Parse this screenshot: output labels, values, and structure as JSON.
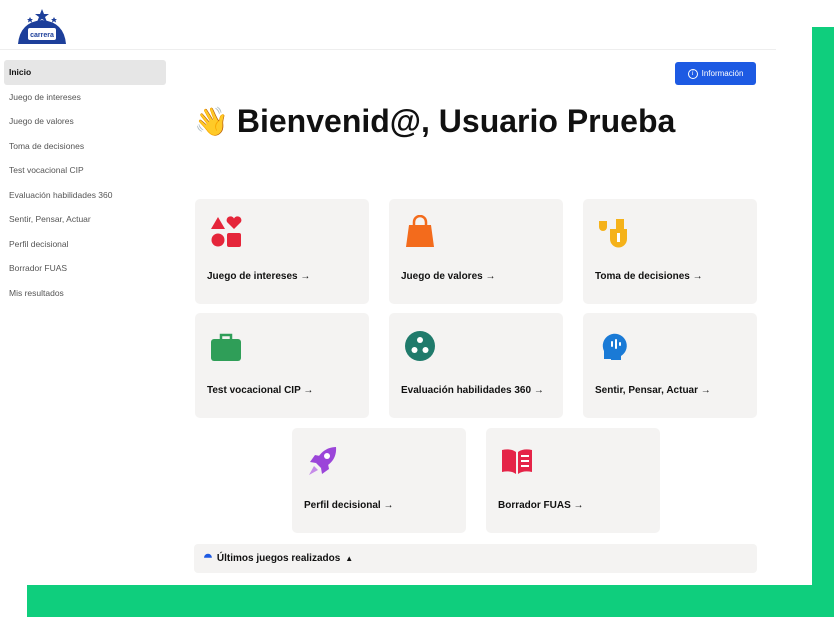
{
  "brand": {
    "logo_text": "carrera"
  },
  "sidebar": {
    "items": [
      {
        "label": "Inicio",
        "active": true
      },
      {
        "label": "Juego de intereses"
      },
      {
        "label": "Juego de valores"
      },
      {
        "label": "Toma de decisiones"
      },
      {
        "label": "Test vocacional CIP"
      },
      {
        "label": "Evaluación habilidades 360"
      },
      {
        "label": "Sentir, Pensar, Actuar"
      },
      {
        "label": "Perfil decisional"
      },
      {
        "label": "Borrador FUAS"
      },
      {
        "label": "Mis resultados"
      }
    ]
  },
  "header": {
    "info_button": "Información",
    "info_icon": "info-icon"
  },
  "welcome": {
    "emoji": "👋",
    "title": "Bienvenid@, Usuario Prueba"
  },
  "cards": [
    {
      "label": "Juego de intereses →",
      "icon": "shapes-icon",
      "color": "#e5253a"
    },
    {
      "label": "Juego de valores →",
      "icon": "shopping-bag-icon",
      "color": "#f36b1c"
    },
    {
      "label": "Toma de decisiones →",
      "icon": "decision-icon",
      "color": "#f5b21a"
    },
    {
      "label": "Test vocacional CIP →",
      "icon": "briefcase-icon",
      "color": "#2f9e58"
    },
    {
      "label": "Evaluación habilidades 360 →",
      "icon": "network-icon",
      "color": "#1f7a6b"
    },
    {
      "label": "Sentir, Pensar, Actuar →",
      "icon": "head-icon",
      "color": "#1a7ad6"
    },
    {
      "label": "Perfil decisional →",
      "icon": "rocket-icon",
      "color": "#9b45d9"
    },
    {
      "label": "Borrador FUAS →",
      "icon": "book-icon",
      "color": "#e52448"
    }
  ],
  "recent": {
    "label": "Últimos juegos realizados",
    "caret": "▲"
  },
  "colors": {
    "accent": "#1d5ae3",
    "frame": "#0fce7d",
    "card_bg": "#f4f3f2"
  }
}
